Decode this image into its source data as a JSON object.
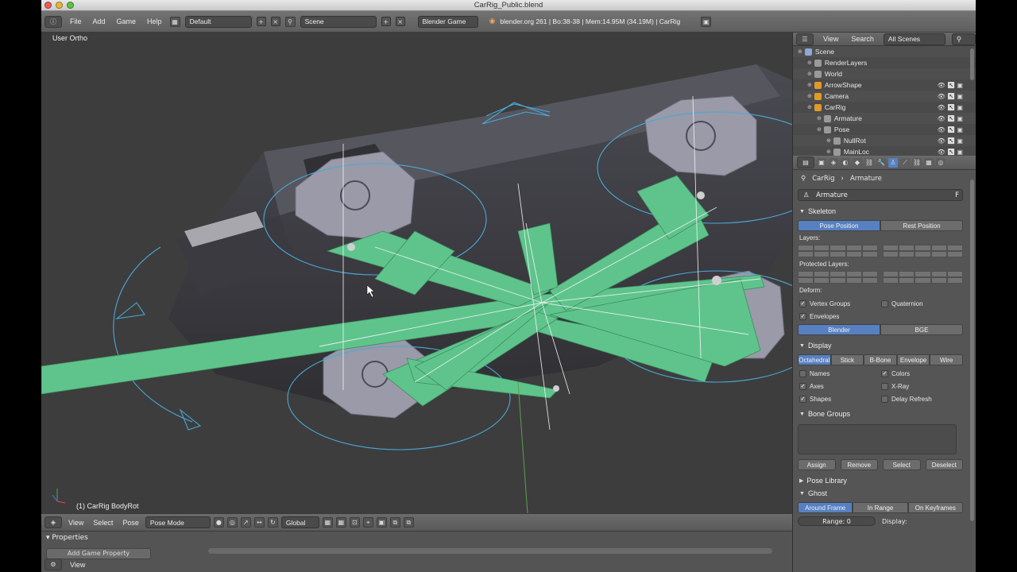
{
  "window": {
    "title": "CarRig_Public.blend"
  },
  "info_header": {
    "menus": [
      "File",
      "Add",
      "Game",
      "Help"
    ],
    "screen_layout": "Default",
    "scene": "Scene",
    "engine": "Blender Game",
    "stats": "blender.org 261 | Bo:38-38 | Mem:14.95M (34.19M) | CarRig"
  },
  "viewport": {
    "view_label": "User Ortho",
    "object_label": "(1) CarRig BodyRot"
  },
  "view3d_header": {
    "menus": [
      "View",
      "Select",
      "Pose"
    ],
    "mode": "Pose Mode",
    "orientation": "Global"
  },
  "logic_panel": {
    "header": "Properties",
    "add_game_property": "Add Game Property",
    "bottom_view": "View"
  },
  "outliner": {
    "menus": [
      "View",
      "Search"
    ],
    "filter": "All Scenes",
    "rows": [
      {
        "label": "Scene",
        "indent": 0,
        "color": "#8da9d4"
      },
      {
        "label": "RenderLayers",
        "indent": 1,
        "color": "#9a9a9a"
      },
      {
        "label": "World",
        "indent": 1,
        "color": "#9a9a9a"
      },
      {
        "label": "ArrowShape",
        "indent": 1,
        "color": "#e09a2a"
      },
      {
        "label": "Camera",
        "indent": 1,
        "color": "#e09a2a"
      },
      {
        "label": "CarRig",
        "indent": 1,
        "color": "#e09a2a"
      },
      {
        "label": "Armature",
        "indent": 2,
        "color": "#9a9a9a"
      },
      {
        "label": "Pose",
        "indent": 2,
        "color": "#9a9a9a"
      },
      {
        "label": "NullRot",
        "indent": 3,
        "color": "#9a9a9a"
      },
      {
        "label": "MainLoc",
        "indent": 3,
        "color": "#9a9a9a"
      }
    ]
  },
  "properties": {
    "breadcrumb": [
      "CarRig",
      "Armature"
    ],
    "datablock_name": "Armature",
    "fake_user": "F",
    "skeleton": {
      "title": "Skeleton",
      "position_buttons": [
        "Pose Position",
        "Rest Position"
      ],
      "layers_label": "Layers:",
      "protected_label": "Protected Layers:",
      "deform_label": "Deform:",
      "vertex_groups": "Vertex Groups",
      "quaternion": "Quaternion",
      "envelopes": "Envelopes",
      "deform_modes": [
        "Blender",
        "BGE"
      ]
    },
    "display": {
      "title": "Display",
      "draw_types": [
        "Octahedral",
        "Stick",
        "B-Bone",
        "Envelope",
        "Wire"
      ],
      "names": "Names",
      "colors": "Colors",
      "axes": "Axes",
      "xray": "X-Ray",
      "shapes": "Shapes",
      "delay_refresh": "Delay Refresh"
    },
    "bone_groups": {
      "title": "Bone Groups",
      "buttons": [
        "Assign",
        "Remove",
        "Select",
        "Deselect"
      ]
    },
    "pose_library": {
      "title": "Pose Library"
    },
    "ghost": {
      "title": "Ghost",
      "modes": [
        "Around Frame",
        "In Range",
        "On Keyframes"
      ],
      "range": "Range: 0",
      "display": "Display:"
    }
  },
  "colors": {
    "bone_green": "#5ec48c",
    "selection_blue": "#5680c2",
    "viewport_bg": "#3d3d3d"
  }
}
